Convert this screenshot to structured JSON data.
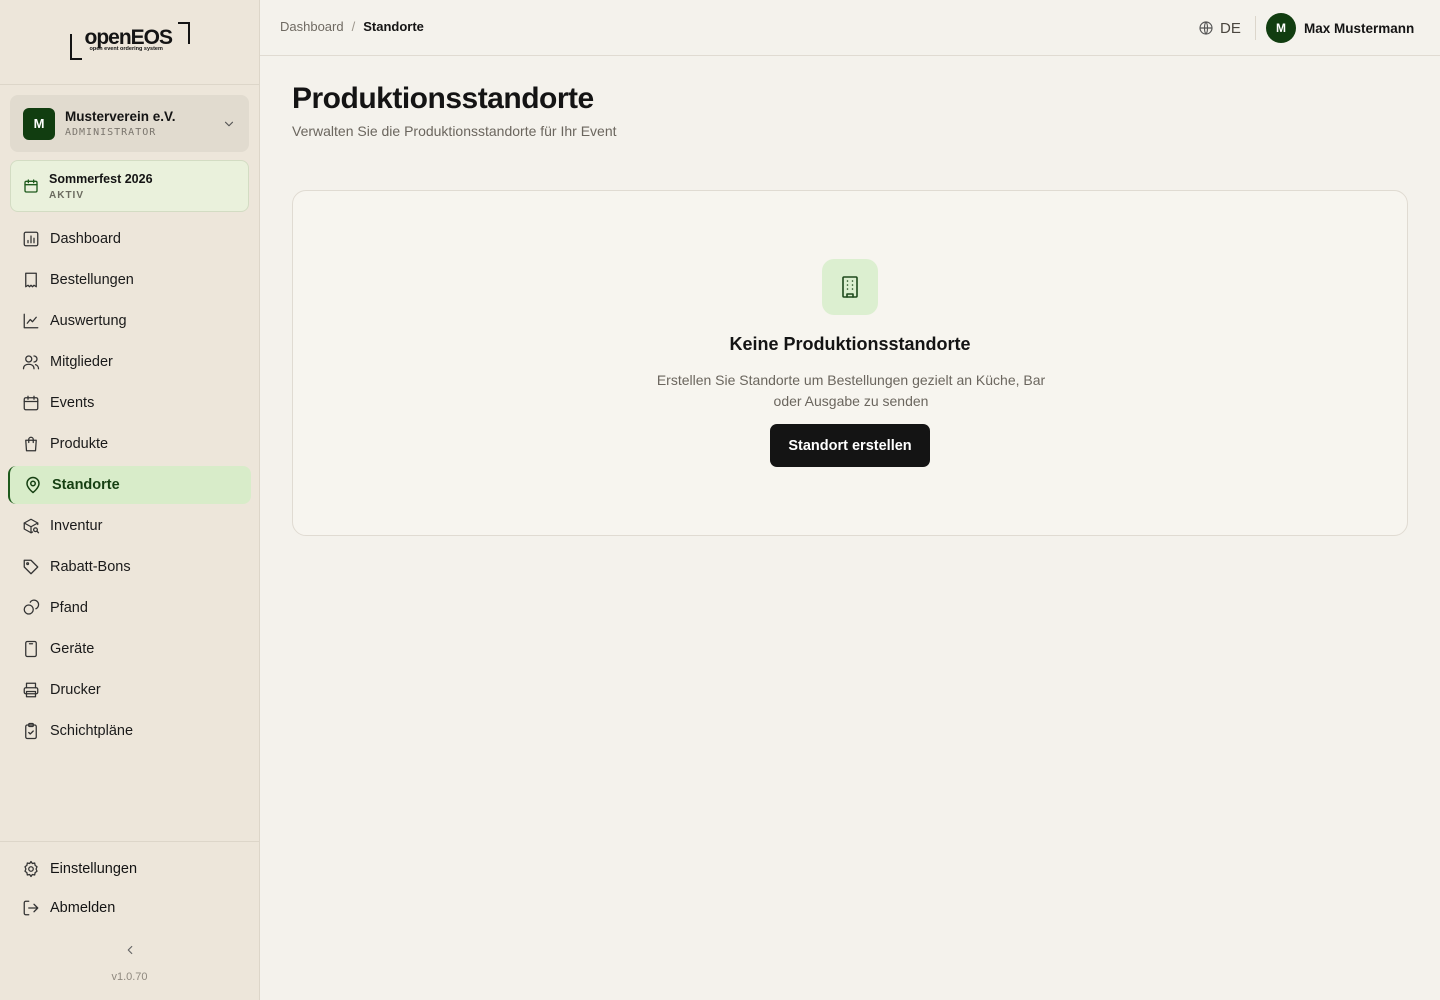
{
  "app": {
    "logo_word": "openEOS",
    "logo_tagline": "open event ordering system",
    "version": "v1.0.70"
  },
  "org": {
    "initial": "M",
    "name": "Musterverein e.V.",
    "role": "ADMINISTRATOR"
  },
  "event": {
    "name": "Sommerfest 2026",
    "status": "AKTIV"
  },
  "nav": {
    "items": [
      {
        "label": "Dashboard",
        "icon": "chart-icon"
      },
      {
        "label": "Bestellungen",
        "icon": "receipt-icon"
      },
      {
        "label": "Auswertung",
        "icon": "trend-icon"
      },
      {
        "label": "Mitglieder",
        "icon": "users-icon"
      },
      {
        "label": "Events",
        "icon": "calendar-icon"
      },
      {
        "label": "Produkte",
        "icon": "shopping-bag-icon"
      },
      {
        "label": "Standorte",
        "icon": "map-pin-icon",
        "active": true
      },
      {
        "label": "Inventur",
        "icon": "package-search-icon"
      },
      {
        "label": "Rabatt-Bons",
        "icon": "tag-icon"
      },
      {
        "label": "Pfand",
        "icon": "coins-icon"
      },
      {
        "label": "Geräte",
        "icon": "tablet-icon"
      },
      {
        "label": "Drucker",
        "icon": "printer-icon"
      },
      {
        "label": "Schichtpläne",
        "icon": "clipboard-check-icon"
      }
    ],
    "settings_label": "Einstellungen",
    "logout_label": "Abmelden"
  },
  "topbar": {
    "breadcrumb": {
      "parent": "Dashboard",
      "separator": "/",
      "current": "Standorte"
    },
    "language": "DE",
    "user": {
      "initial": "M",
      "name": "Max Mustermann"
    }
  },
  "main": {
    "title": "Produktionsstandorte",
    "subtitle": "Verwalten Sie die Produktionsstandorte für Ihr Event",
    "empty": {
      "icon": "building-icon",
      "title": "Keine Produktionsstandorte",
      "description": "Erstellen Sie Standorte um Bestellungen gezielt an Küche, Bar oder Ausgabe zu senden",
      "button_label": "Standort erstellen"
    }
  },
  "colors": {
    "brand_dark": "#113d10",
    "active_bg": "#d8ecc9",
    "sidebar_bg": "#ede6da",
    "page_bg": "#f4f2ec",
    "button_bg": "#141414"
  }
}
